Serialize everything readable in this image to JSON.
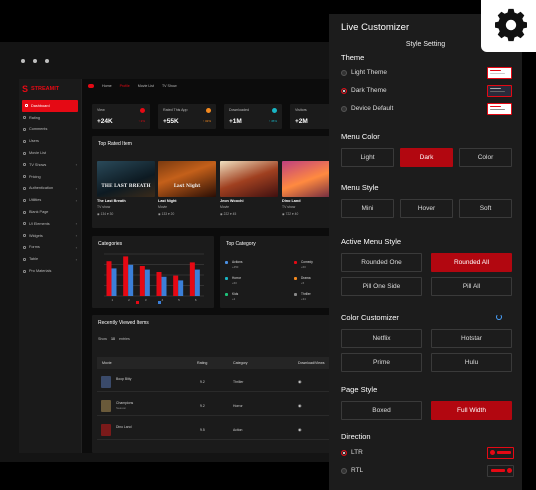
{
  "app": {
    "brand": "STREAMIT",
    "breadcrumb": [
      "Home",
      "Profile",
      "Movie List",
      "TV Show"
    ],
    "sidebar": [
      "Dashboard",
      "Rating",
      "Comments",
      "Users",
      "Movie List",
      "TV Shows",
      "Pricing",
      "Authentication",
      "Utilities",
      "Blank Page",
      "UI Elements",
      "Widgets",
      "Forms",
      "Table",
      "Pro Materials"
    ],
    "stats": [
      {
        "label": "View",
        "value": "+24K",
        "pct": "↑ 2%",
        "color": "#e50914"
      },
      {
        "label": "Rated This App",
        "value": "+55K",
        "pct": "↑ 32%",
        "color": "#f58a1f"
      },
      {
        "label": "Downloaded",
        "value": "+1M",
        "pct": "↑ 45%",
        "color": "#19b5c4"
      },
      {
        "label": "Visitors",
        "value": "+2M",
        "pct": "↑ 2%",
        "color": "#e50914"
      }
    ],
    "top_rated": {
      "title": "Top Rated Item",
      "movies": [
        {
          "title": "The Last Breath",
          "type": "TV show",
          "views": "134",
          "likes": "30",
          "poster": "THE LAST BREATH"
        },
        {
          "title": "Last Night",
          "type": "Movie",
          "views": "133",
          "likes": "20",
          "poster": "Last Night"
        },
        {
          "title": "Jeon Woochi",
          "type": "Movie",
          "views": "222",
          "likes": "45",
          "poster": ""
        },
        {
          "title": "Dino Land",
          "type": "TV show",
          "views": "722",
          "likes": "40",
          "poster": ""
        }
      ]
    },
    "categories_title": "Categories",
    "top_category": {
      "title": "Top Category",
      "items": [
        {
          "name": "Actions",
          "sub": "+450",
          "color": "#4a90e2"
        },
        {
          "name": "Comedy",
          "sub": "+60",
          "color": "#e50914"
        },
        {
          "name": "Horror",
          "sub": "+60",
          "color": "#19b5c4"
        },
        {
          "name": "Drama",
          "sub": "+5",
          "color": "#f58a1f"
        },
        {
          "name": "Kids",
          "sub": "+2",
          "color": "#1ec27a"
        },
        {
          "name": "Thriller",
          "sub": "+34",
          "color": "#888"
        }
      ]
    },
    "recent": {
      "title": "Recently Viewed Items",
      "show": "Show",
      "show_count": "10",
      "entries": "entries",
      "headers": [
        "Movie",
        "Rating",
        "Category",
        "Download/Views",
        "User"
      ],
      "rows": [
        {
          "movie": "Boop Bitty",
          "sub": "",
          "rating": "9.2",
          "category": "Thriller"
        },
        {
          "movie": "Champions",
          "sub": "Season",
          "rating": "9.2",
          "category": "Horror"
        },
        {
          "movie": "Dino Land",
          "sub": "",
          "rating": "9.5",
          "category": "Action"
        }
      ]
    }
  },
  "chart_data": {
    "type": "bar",
    "title": "",
    "xlabel": "",
    "ylabel": "",
    "categories": [
      "1",
      "2",
      "3",
      "4",
      "5",
      "6"
    ],
    "series": [
      {
        "name": "",
        "values": [
          58,
          66,
          50,
          40,
          34,
          56
        ]
      },
      {
        "name": "",
        "values": [
          46,
          52,
          44,
          32,
          26,
          44
        ]
      }
    ],
    "ylim": [
      0,
      70
    ],
    "colors": [
      "#e50914",
      "#3b7fd9"
    ],
    "grid": true
  },
  "customizer": {
    "title": "Live Customizer",
    "subtitle": "Style Setting",
    "theme": {
      "label": "Theme",
      "options": [
        "Light Theme",
        "Dark Theme",
        "Device Default"
      ],
      "selected": 1
    },
    "menu_color": {
      "label": "Menu Color",
      "options": [
        "Light",
        "Dark",
        "Color"
      ],
      "selected": 1
    },
    "menu_style": {
      "label": "Menu Style",
      "options": [
        "Mini",
        "Hover",
        "Soft"
      ],
      "selected": -1
    },
    "active_menu_style": {
      "label": "Active Menu Style",
      "options": [
        "Rounded One",
        "Rounded All",
        "Pill One Side",
        "Pill All"
      ],
      "selected": 1
    },
    "color_customizer": {
      "label": "Color Customizer",
      "options": [
        "Netflix",
        "Hotstar",
        "Prime",
        "Hulu"
      ],
      "selected": -1
    },
    "page_style": {
      "label": "Page Style",
      "options": [
        "Boxed",
        "Full Width"
      ],
      "selected": 1
    },
    "direction": {
      "label": "Direction",
      "options": [
        "LTR",
        "RTL"
      ],
      "selected": 0
    }
  },
  "icons": [
    "settings-gear-icon",
    "window-dots-icon"
  ],
  "accent": "#e50914"
}
